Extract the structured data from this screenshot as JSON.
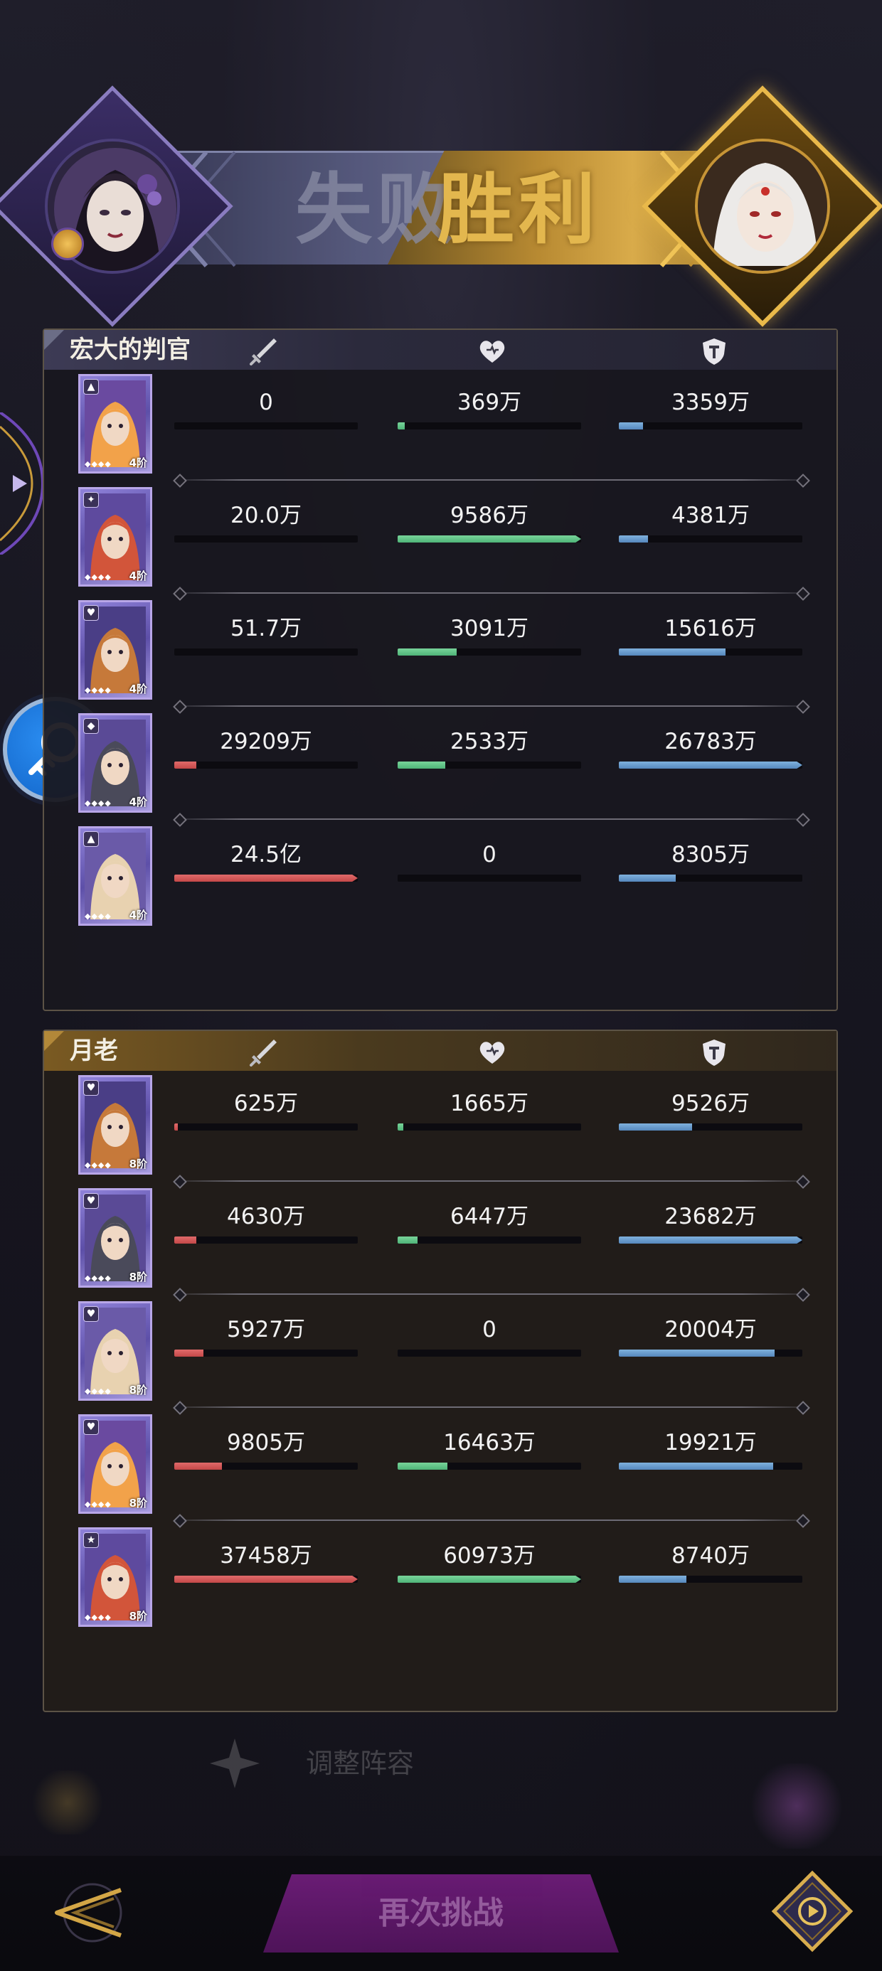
{
  "banner": {
    "lose_text": "失败",
    "win_text": "胜利",
    "left_avatar": "gothic-lady-avatar",
    "right_avatar": "white-hair-lady-avatar"
  },
  "colors": {
    "damage": "#d45a5a",
    "heal": "#62c488",
    "tank": "#6a9fcf",
    "gold": "#e3b74e"
  },
  "teams": [
    {
      "name": "宏大的判官",
      "stat_icons": [
        "sword-icon",
        "heart-icon",
        "shield-icon"
      ],
      "heroes": [
        {
          "badge": "▲",
          "level": "4阶",
          "damage": "0",
          "damage_pct": 0,
          "heal": "369万",
          "heal_pct": 0.04,
          "tank": "3359万",
          "tank_pct": 0.13
        },
        {
          "badge": "✦",
          "level": "4阶",
          "damage": "20.0万",
          "damage_pct": 0,
          "heal": "9586万",
          "heal_pct": 1.0,
          "tank": "4381万",
          "tank_pct": 0.16
        },
        {
          "badge": "♥",
          "level": "4阶",
          "damage": "51.7万",
          "damage_pct": 0,
          "heal": "3091万",
          "heal_pct": 0.32,
          "tank": "15616万",
          "tank_pct": 0.58
        },
        {
          "badge": "◆",
          "level": "4阶",
          "damage": "29209万",
          "damage_pct": 0.12,
          "heal": "2533万",
          "heal_pct": 0.26,
          "tank": "26783万",
          "tank_pct": 1.0
        },
        {
          "badge": "▲",
          "level": "4阶",
          "damage": "24.5亿",
          "damage_pct": 1.0,
          "heal": "0",
          "heal_pct": 0,
          "tank": "8305万",
          "tank_pct": 0.31
        }
      ]
    },
    {
      "name": "月老",
      "stat_icons": [
        "sword-icon",
        "heart-icon",
        "shield-icon"
      ],
      "heroes": [
        {
          "badge": "♥",
          "level": "8阶",
          "damage": "625万",
          "damage_pct": 0.02,
          "heal": "1665万",
          "heal_pct": 0.03,
          "tank": "9526万",
          "tank_pct": 0.4
        },
        {
          "badge": "♥",
          "level": "8阶",
          "damage": "4630万",
          "damage_pct": 0.12,
          "heal": "6447万",
          "heal_pct": 0.11,
          "tank": "23682万",
          "tank_pct": 1.0
        },
        {
          "badge": "♥",
          "level": "8阶",
          "damage": "5927万",
          "damage_pct": 0.16,
          "heal": "0",
          "heal_pct": 0,
          "tank": "20004万",
          "tank_pct": 0.85
        },
        {
          "badge": "♥",
          "level": "8阶",
          "damage": "9805万",
          "damage_pct": 0.26,
          "heal": "16463万",
          "heal_pct": 0.27,
          "tank": "19921万",
          "tank_pct": 0.84
        },
        {
          "badge": "★",
          "level": "8阶",
          "damage": "37458万",
          "damage_pct": 1.0,
          "heal": "60973万",
          "heal_pct": 1.0,
          "tank": "8740万",
          "tank_pct": 0.37
        }
      ]
    }
  ],
  "bottom": {
    "again_label": "再次挑战",
    "ghost_label": "调整阵容"
  }
}
